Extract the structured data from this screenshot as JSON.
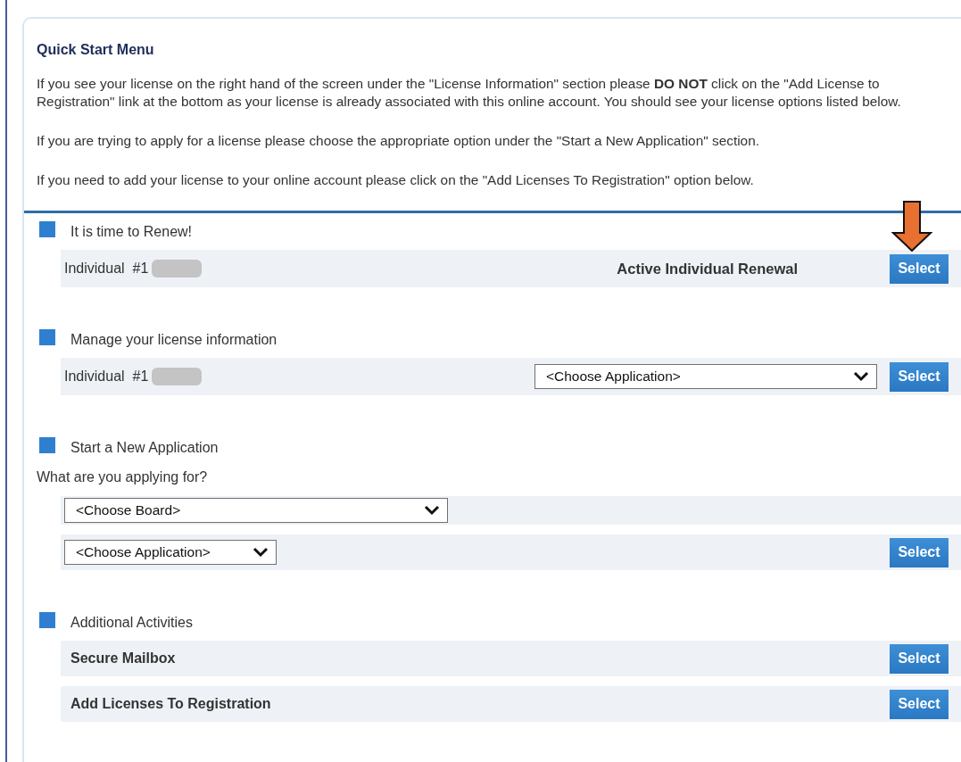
{
  "panel": {
    "title": "Quick Start Menu",
    "paragraphs": [
      "If you see your license on the right hand of the screen under the \"License Information\" section please **DO NOT** click on the \"Add License to Registration\" link at the bottom as your license is already associated with this online account. You should see your license options listed below.",
      "If you are trying to apply for a license please choose the appropriate option under the \"Start a New Application\" section.",
      "If you need to add your license to your online account please click on the \"Add Licenses To Registration\" option below."
    ]
  },
  "sections": [
    {
      "heading": "It is time to Renew!",
      "rows": [
        {
          "kind": "license",
          "label": "Individual  #1",
          "status": "Active Individual Renewal",
          "button": "Select",
          "highlighted": true
        }
      ]
    },
    {
      "heading": "Manage your license information",
      "rows": [
        {
          "kind": "license",
          "label": "Individual  #1",
          "dropdown": "<Choose Application>",
          "button": "Select"
        }
      ]
    },
    {
      "heading": "Start a New Application",
      "question": "What are you applying for?",
      "rows": [
        {
          "kind": "choice",
          "dropdown": "<Choose Board>"
        },
        {
          "kind": "choice",
          "dropdown": "<Choose Application>",
          "button": "Select"
        }
      ]
    },
    {
      "heading": "Additional Activities",
      "rows": [
        {
          "kind": "activity",
          "label": "Secure Mailbox",
          "button": "Select"
        },
        {
          "kind": "activity",
          "label": "Add Licenses To Registration",
          "button": "Select"
        }
      ]
    }
  ]
}
